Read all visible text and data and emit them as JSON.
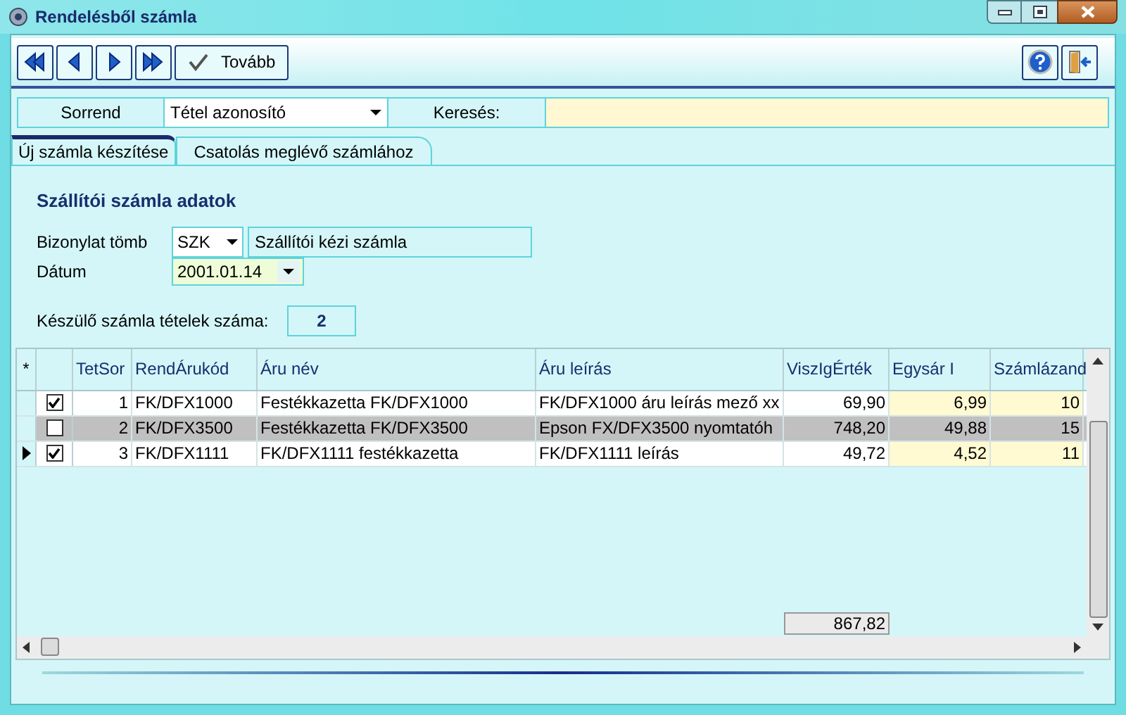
{
  "window": {
    "title": "Rendelésből számla"
  },
  "toolbar": {
    "next_label": "Tovább"
  },
  "filter": {
    "sort_label": "Sorrend",
    "sort_value": "Tétel azonosító",
    "search_label": "Keresés:"
  },
  "tabs": [
    {
      "label": "Új számla készítése",
      "selected": true
    },
    {
      "label": "Csatolás meglévő számlához",
      "selected": false
    }
  ],
  "section_title": "Szállítói számla adatok",
  "fields": {
    "doc_label": "Bizonylat tömb",
    "doc_code": "SZK",
    "doc_name": "Szállítói kézi számla",
    "date_label": "Dátum",
    "date_value": "2001.01.14",
    "count_label": "Készülő számla tételek száma:",
    "count_value": "2"
  },
  "table": {
    "marker_header": "*",
    "columns": [
      "TetSor",
      "RendÁrukód",
      "Áru név",
      "Áru leírás",
      "ViszIgÉrték",
      "Egysár I",
      "Számlázand"
    ],
    "rows": [
      {
        "current": false,
        "checked": true,
        "selected": false,
        "cells": [
          "1",
          "FK/DFX1000",
          "Festékkazetta FK/DFX1000",
          "FK/DFX1000 áru leírás mező xx",
          "69,90",
          "6,99",
          "10"
        ]
      },
      {
        "current": false,
        "checked": false,
        "selected": true,
        "cells": [
          "2",
          "FK/DFX3500",
          "Festékkazetta FK/DFX3500",
          "Epson FX/DFX3500 nyomtatóh",
          "748,20",
          "49,88",
          "15"
        ]
      },
      {
        "current": true,
        "checked": true,
        "selected": false,
        "cells": [
          "3",
          "FK/DFX1111",
          "FK/DFX1111 festékkazetta",
          "FK/DFX1111 leírás",
          "49,72",
          "4,52",
          "11"
        ]
      }
    ],
    "total": "867,82"
  }
}
